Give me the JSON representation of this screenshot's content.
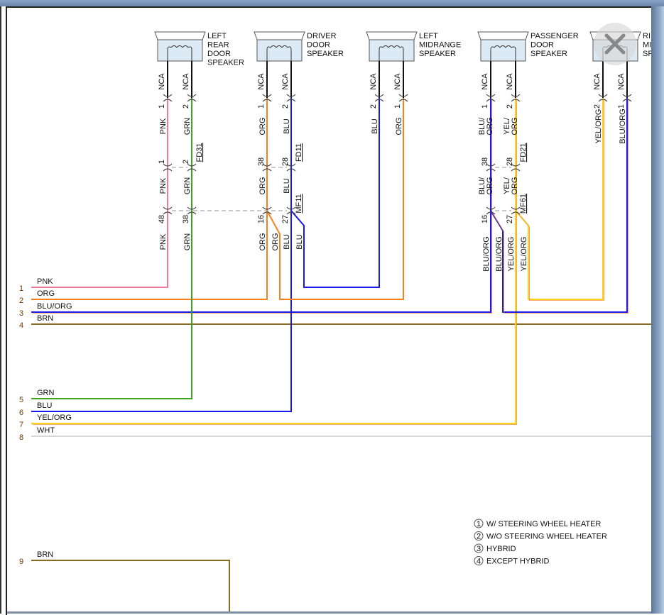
{
  "colors": {
    "PNK": "#f27a9a",
    "GRN": "#3aa61a",
    "ORG": "#f58220",
    "BLU": "#1a1ae6",
    "BRN": "#8a6a1e",
    "WHT": "#d8d8d8",
    "YEL": "#ffd21f",
    "NCA": "#111111",
    "frame": "#6a86ab"
  },
  "speakers": [
    {
      "name": [
        "LEFT",
        "REAR",
        "DOOR",
        "SPEAKER"
      ],
      "pins": [
        {
          "nca": "NCA",
          "pin": "1",
          "color": "PNK"
        },
        {
          "nca": "NCA",
          "pin": "2",
          "color": "GRN"
        }
      ]
    },
    {
      "name": [
        "DRIVER",
        "DOOR",
        "SPEAKER"
      ],
      "pins": [
        {
          "nca": "NCA",
          "pin": "1",
          "color": "ORG"
        },
        {
          "nca": "NCA",
          "pin": "2",
          "color": "BLU"
        }
      ]
    },
    {
      "name": [
        "LEFT",
        "MIDRANGE",
        "SPEAKER"
      ],
      "pins": [
        {
          "nca": "NCA",
          "pin": "2",
          "color": "BLU"
        },
        {
          "nca": "NCA",
          "pin": "1",
          "color": "ORG"
        }
      ]
    },
    {
      "name": [
        "PASSENGER",
        "DOOR",
        "SPEAKER"
      ],
      "pins": [
        {
          "nca": "NCA",
          "pin": "1",
          "color": "BLU/ ORG"
        },
        {
          "nca": "NCA",
          "pin": "2",
          "color": "YEL/ ORG"
        }
      ]
    },
    {
      "name": [
        "RI",
        "MI",
        "SP"
      ],
      "pins": [
        {
          "nca": "NCA",
          "pin": "2",
          "color": "YEL/ORG"
        },
        {
          "nca": "NCA",
          "pin": "1",
          "color": "BLU/ORG"
        }
      ]
    }
  ],
  "fd_connectors": [
    {
      "id": "FD31",
      "pins": [
        "1",
        "2"
      ],
      "colors": [
        "PNK",
        "GRN"
      ]
    },
    {
      "id": "FD11",
      "pins": [
        "38",
        "28"
      ],
      "colors": [
        "ORG",
        "BLU"
      ]
    },
    {
      "id": "FD21",
      "pins": [
        "38",
        "28"
      ],
      "colors": [
        "BLU/ ORG",
        "YEL/ ORG"
      ]
    }
  ],
  "mf_connectors": [
    {
      "id": "",
      "pins": [
        "48",
        "38"
      ],
      "colors": [
        "PNK",
        "GRN"
      ]
    },
    {
      "id": "MF11",
      "pins": [
        "16",
        "27"
      ],
      "colors": [
        "ORG",
        "ORG",
        "BLU",
        "BLU"
      ]
    },
    {
      "id": "MF61",
      "pins": [
        "16",
        "27"
      ],
      "colors": [
        "BLU/ORG",
        "BLU/ORG",
        "YEL/ORG",
        "YEL/ORG"
      ]
    }
  ],
  "rows": [
    {
      "num": "1",
      "label": "PNK"
    },
    {
      "num": "2",
      "label": "ORG"
    },
    {
      "num": "3",
      "label": "BLU/ORG"
    },
    {
      "num": "4",
      "label": "BRN"
    },
    {
      "num": "5",
      "label": "GRN"
    },
    {
      "num": "6",
      "label": "BLU"
    },
    {
      "num": "7",
      "label": "YEL/ORG"
    },
    {
      "num": "8",
      "label": "WHT"
    },
    {
      "num": "9",
      "label": "BRN"
    }
  ],
  "legend": [
    {
      "num": "1",
      "text": "W/ STEERING WHEEL HEATER"
    },
    {
      "num": "2",
      "text": "W/O STEERING WHEEL HEATER"
    },
    {
      "num": "3",
      "text": "HYBRID"
    },
    {
      "num": "4",
      "text": "EXCEPT HYBRID"
    }
  ],
  "close_icon": "close-x-icon"
}
